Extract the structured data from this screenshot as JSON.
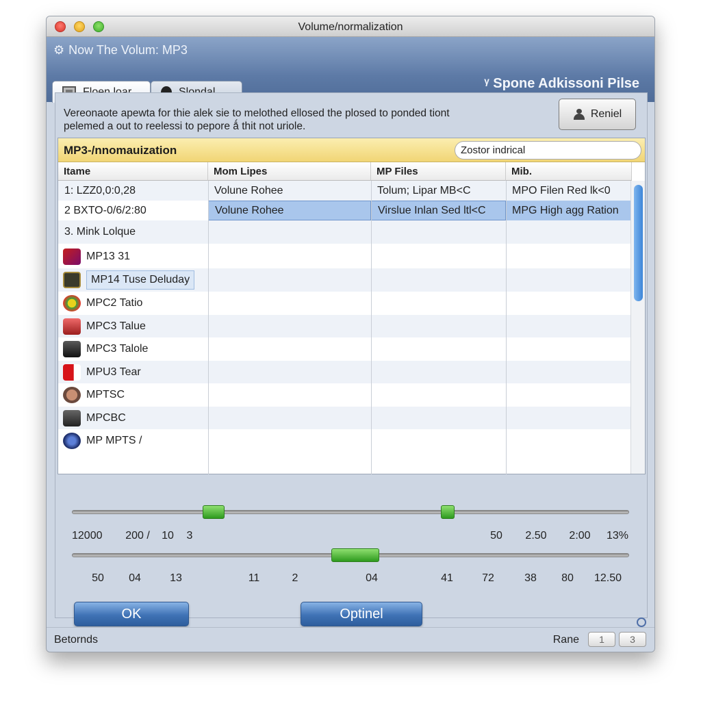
{
  "window": {
    "title": "Volume/normalization"
  },
  "banner": {
    "left_label": "Now The Volum:  MP3",
    "right_label": "ᵞ Spone Adkissoni Pilse"
  },
  "tabs": [
    {
      "label": "Floen loar",
      "icon": "window-icon",
      "active": true
    },
    {
      "label": "Slondal",
      "icon": "apple-icon",
      "active": false
    }
  ],
  "description": {
    "line1": "Vereonaote apewta  for thie alek sie to melothed ellosed the plosed to ponded tiont",
    "line2": "pelemed a out to reelessi to pepore ǻ thit not uriole."
  },
  "reset_button": {
    "label": "Reniel",
    "icon": "person-icon"
  },
  "panel": {
    "title": "MP3-/nnomauization",
    "search_value": "Zostor indrical",
    "columns": [
      "Itame",
      "Mom Lipes",
      "MP Files",
      "Mib."
    ],
    "rows": [
      {
        "name": "1: LZZ0,0:0,28",
        "col1": "Volune Rohee",
        "col2": "Tolum; Lipar MB<C",
        "col3": "MPO Filen Red lk<0",
        "icon": "",
        "selected": false
      },
      {
        "name": "2  BXTO-0/6/2:80",
        "col1": "Volune Rohee",
        "col2": "Virslue Inlan Sed ltl<C",
        "col3": "MPG High agg Ration",
        "icon": "",
        "selected": true
      },
      {
        "name": "3. Mink Lolque",
        "col1": "",
        "col2": "",
        "col3": "",
        "icon": "",
        "selected": false
      },
      {
        "name": "MP13 31",
        "col1": "",
        "col2": "",
        "col3": "",
        "icon": "no-entry-icon",
        "selected": false
      },
      {
        "name": "MP14 Tuse Deluday",
        "col1": "",
        "col2": "",
        "col3": "",
        "icon": "film-icon",
        "selected": false,
        "boxed": true
      },
      {
        "name": "MPC2 Tatio",
        "col1": "",
        "col2": "",
        "col3": "",
        "icon": "flower-icon",
        "selected": false
      },
      {
        "name": "MPC3 Talue",
        "col1": "",
        "col2": "",
        "col3": "",
        "icon": "app-icon",
        "selected": false
      },
      {
        "name": "MPC3 Talole",
        "col1": "",
        "col2": "",
        "col3": "",
        "icon": "terminal-icon",
        "selected": false
      },
      {
        "name": "MPU3 Tear",
        "col1": "",
        "col2": "",
        "col3": "",
        "icon": "flag-icon",
        "selected": false
      },
      {
        "name": "MPTSC",
        "col1": "",
        "col2": "",
        "col3": "",
        "icon": "face-icon",
        "selected": false
      },
      {
        "name": "MPCBC",
        "col1": "",
        "col2": "",
        "col3": "",
        "icon": "apple-logo-icon",
        "selected": false
      },
      {
        "name": "MP MPTS /",
        "col1": "",
        "col2": "",
        "col3": "",
        "icon": "globe-icon",
        "selected": false
      }
    ]
  },
  "slider1": {
    "labels": [
      "12000",
      "200 /",
      "10",
      "3",
      "50",
      "2.50",
      "2:00",
      "13%"
    ]
  },
  "slider2": {
    "labels": [
      "50",
      "04",
      "13",
      "11",
      "2",
      "04",
      "41",
      "72",
      "38",
      "80",
      "12.50"
    ]
  },
  "buttons": {
    "ok": "OK",
    "option": "Optinel"
  },
  "statusbar": {
    "left": "Betornds",
    "right": "Rane",
    "page1": "1",
    "page2": "3"
  },
  "colors": {
    "accent": "#3f72b5",
    "slider_knob": "#4cbb2f",
    "panel_header": "#f3dc85",
    "selection": "#a9c6ec"
  }
}
